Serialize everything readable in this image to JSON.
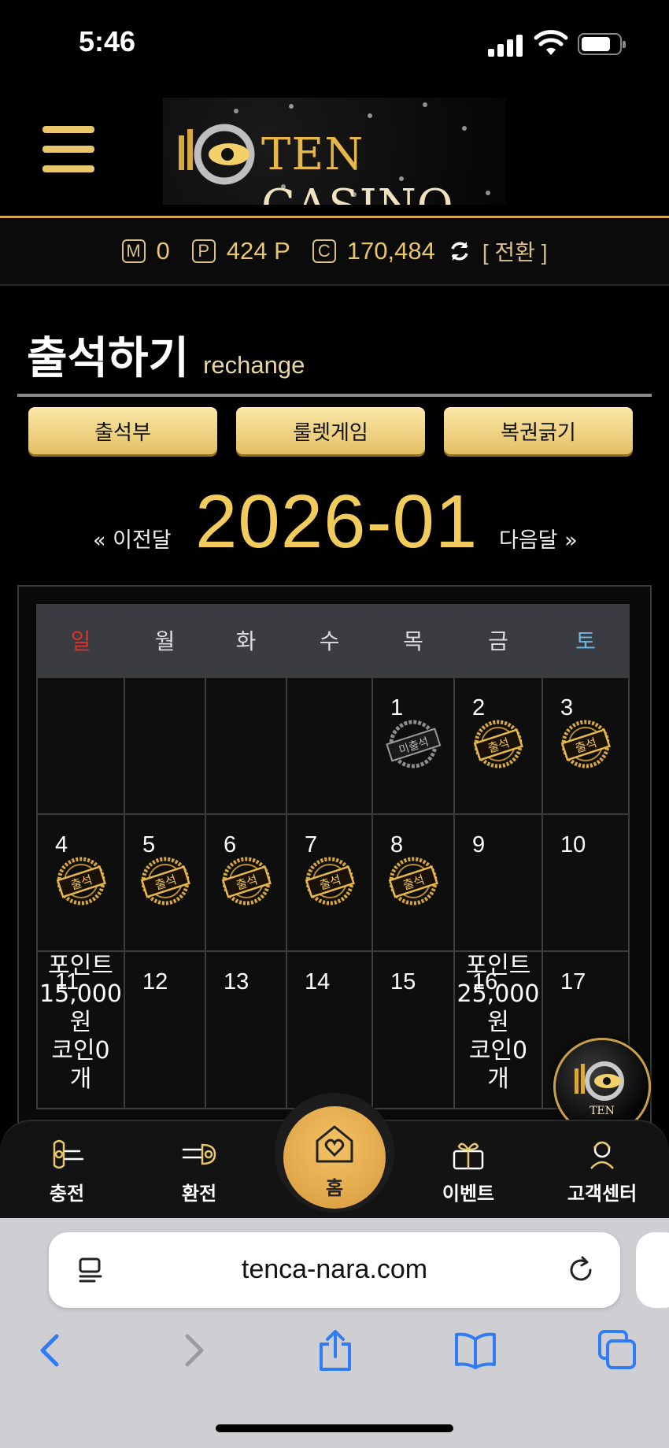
{
  "status_bar": {
    "time": "5:46"
  },
  "header": {
    "logo_text_ten": "TEN",
    "logo_text_casino": "CASINO"
  },
  "balance": {
    "money_tag": "M",
    "money": "0",
    "point_tag": "P",
    "point": "424 P",
    "coin_tag": "C",
    "coin": "170,484",
    "switch_label": "[ 전환 ]"
  },
  "page": {
    "title": "출석하기",
    "subtitle": "rechange"
  },
  "tabs": [
    "출석부",
    "룰렛게임",
    "복권긁기"
  ],
  "month_nav": {
    "prev": "« 이전달",
    "current": "2026-01",
    "next": "다음달 »"
  },
  "calendar": {
    "weekdays": [
      "일",
      "월",
      "화",
      "수",
      "목",
      "금",
      "토"
    ],
    "weekday_colors": {
      "sun": "#e0302c",
      "sat": "#6fb6e8",
      "other": "#dddddd"
    },
    "week1": [
      "",
      "",
      "",
      "",
      "1",
      "2",
      "3"
    ],
    "week2": [
      "4",
      "5",
      "6",
      "7",
      "8",
      "9",
      "10"
    ],
    "week3": [
      "11",
      "12",
      "13",
      "14",
      "15",
      "16",
      "17"
    ],
    "stamp_attended": "출석",
    "stamp_missed": "미출석",
    "reward_11": [
      "포인트",
      "15,000",
      "원",
      "코인0",
      "개"
    ],
    "reward_16": [
      "포인트",
      "25,000",
      "원",
      "코인0",
      "개"
    ]
  },
  "bottom_nav": {
    "charge": "충전",
    "exchange": "환전",
    "home": "홈",
    "event": "이벤트",
    "support": "고객센터"
  },
  "browser": {
    "url": "tenca-nara.com"
  },
  "colors": {
    "gold": "#e8c66d",
    "accent": "#f2cb5d",
    "safari_blue": "#2f7cf6"
  }
}
